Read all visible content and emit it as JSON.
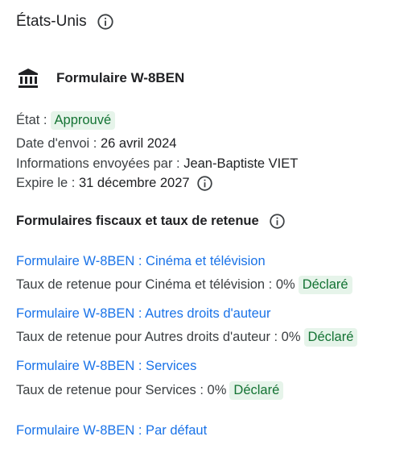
{
  "country": {
    "name": "États-Unis",
    "info_icon": "info-icon"
  },
  "form": {
    "icon": "bank-icon",
    "name": "Formulaire W-8BEN"
  },
  "details": {
    "status_label": "État :",
    "status_value": "Approuvé",
    "sent_label": "Date d'envoi :",
    "sent_value": "26 avril 2024",
    "sent_by_label": "Informations envoyées par :",
    "sent_by_value": "Jean-Baptiste VIET",
    "expires_label": "Expire le :",
    "expires_value": "31 décembre 2027"
  },
  "section": {
    "title": "Formulaires fiscaux et taux de retenue"
  },
  "tax_forms": [
    {
      "link": "Formulaire W-8BEN : Cinéma et télévision",
      "rate_text": "Taux de retenue pour Cinéma et télévision : 0%",
      "badge": "Déclaré"
    },
    {
      "link": "Formulaire W-8BEN : Autres droits d'auteur",
      "rate_text": "Taux de retenue pour Autres droits d'auteur : 0%",
      "badge": "Déclaré"
    },
    {
      "link": "Formulaire W-8BEN : Services",
      "rate_text": "Taux de retenue pour Services : 0%",
      "badge": "Déclaré"
    },
    {
      "link": "Formulaire W-8BEN : Par défaut"
    }
  ],
  "colors": {
    "link": "#1a73e8",
    "badge_bg": "#e6f4ea",
    "badge_text": "#137333",
    "text": "#202124"
  }
}
